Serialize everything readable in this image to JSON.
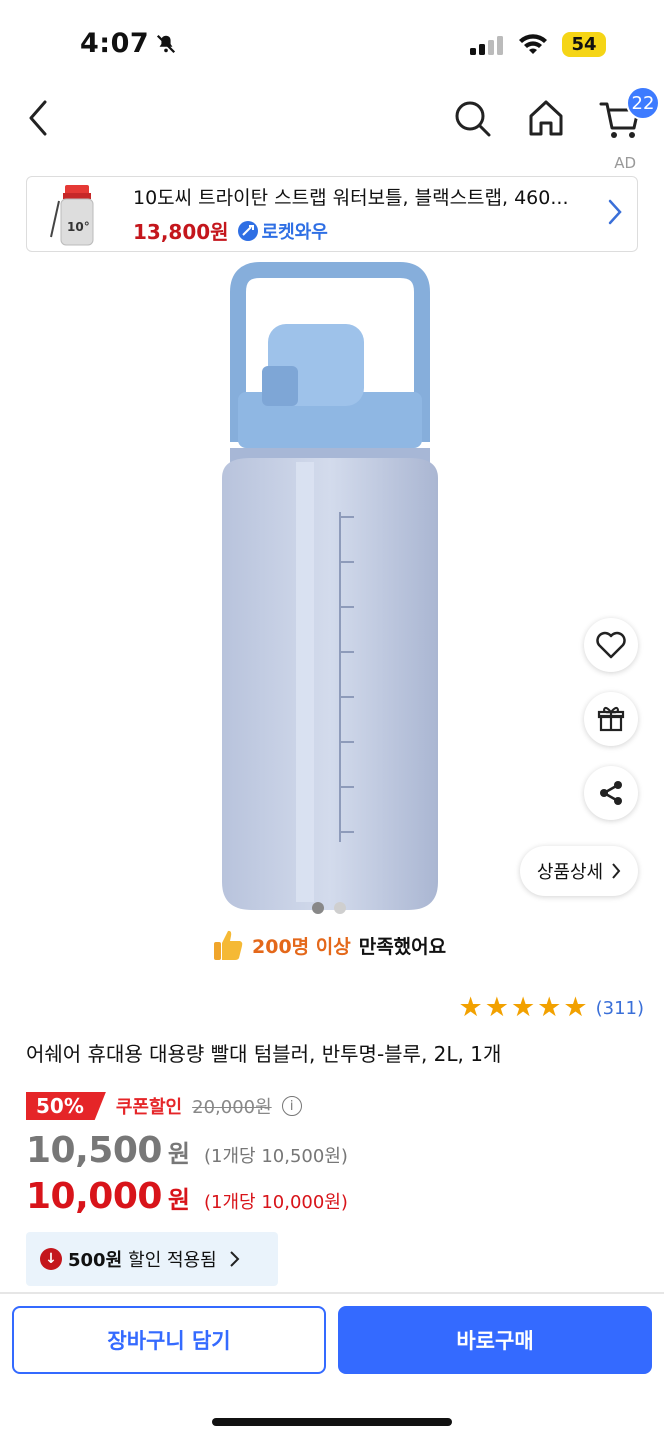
{
  "status_bar": {
    "time": "4:07",
    "battery": "54"
  },
  "nav": {
    "cart_badge": "22",
    "ad_label": "AD"
  },
  "ad": {
    "title": "10도씨 트라이탄 스트랩 워터보틀, 블랙스트랩, 460...",
    "price": "13,800원",
    "rocket_label": "로켓와우"
  },
  "gallery": {
    "detail_label": "상품상세",
    "current_index": 1,
    "total": 2
  },
  "satisfaction": {
    "highlight": "200명 이상",
    "rest": "만족했어요"
  },
  "rating": {
    "stars": 5,
    "count": "(311)"
  },
  "product": {
    "title": "어쉐어 휴대용 대용량 빨대 텀블러, 반투명-블루, 2L, 1개"
  },
  "pricing": {
    "discount": "50%",
    "coupon_label": "쿠폰할인",
    "original_price": "20,000원",
    "price1": "10,500",
    "price1_won": "원",
    "price1_unit": "(1개당 10,500원)",
    "price2": "10,000",
    "price2_won": "원",
    "price2_unit": "(1개당 10,000원)",
    "applied_amount": "500원",
    "applied_text": "할인 적용됨"
  },
  "footer": {
    "cart_button": "장바구니 담기",
    "buy_button": "바로구매"
  },
  "colors": {
    "primary": "#346aff",
    "sale_red": "#e52528",
    "star": "#f2a100"
  }
}
